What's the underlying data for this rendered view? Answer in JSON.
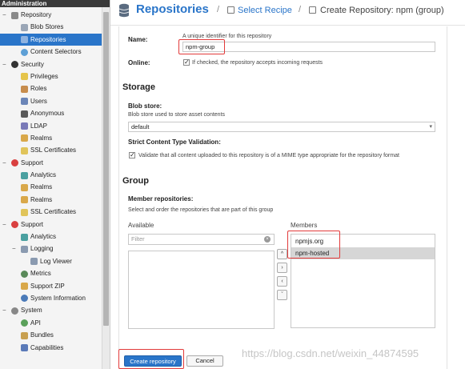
{
  "sidebar": {
    "header": "Administration",
    "items": [
      {
        "label": "Repository",
        "level": 0,
        "icon": "repository-icon",
        "toggle": "−",
        "color": "#8a8a8a",
        "dot": false,
        "active": false
      },
      {
        "label": "Blob Stores",
        "level": 1,
        "icon": "blob-stores-icon",
        "color": "#9aa6b6",
        "dot": false,
        "active": false
      },
      {
        "label": "Repositories",
        "level": 1,
        "icon": "repositories-icon",
        "color": "#8fb3e0",
        "dot": false,
        "active": true
      },
      {
        "label": "Content Selectors",
        "level": 1,
        "icon": "content-selectors-icon",
        "color": "#5ea0d6",
        "dot": true,
        "active": false
      },
      {
        "label": "Security",
        "level": 0,
        "icon": "security-icon",
        "toggle": "−",
        "color": "#333333",
        "dot": true,
        "active": false
      },
      {
        "label": "Privileges",
        "level": 1,
        "icon": "privileges-icon",
        "color": "#e5c44a",
        "dot": false,
        "active": false
      },
      {
        "label": "Roles",
        "level": 1,
        "icon": "roles-icon",
        "color": "#c78d4d",
        "dot": false,
        "active": false
      },
      {
        "label": "Users",
        "level": 1,
        "icon": "users-icon",
        "color": "#6b86b8",
        "dot": false,
        "active": false
      },
      {
        "label": "Anonymous",
        "level": 1,
        "icon": "anonymous-icon",
        "color": "#5a5a5a",
        "dot": false,
        "active": false
      },
      {
        "label": "LDAP",
        "level": 1,
        "icon": "ldap-icon",
        "color": "#7a7ab8",
        "dot": false,
        "active": false
      },
      {
        "label": "Realms",
        "level": 1,
        "icon": "realms-icon",
        "color": "#d9a84a",
        "dot": false,
        "active": false
      },
      {
        "label": "SSL Certificates",
        "level": 1,
        "icon": "ssl-certificates-icon",
        "color": "#e0c45a",
        "dot": false,
        "active": false
      },
      {
        "label": "Support",
        "level": 0,
        "icon": "support-icon",
        "toggle": "−",
        "color": "#d94040",
        "dot": true,
        "active": false
      },
      {
        "label": "Analytics",
        "level": 1,
        "icon": "analytics-icon",
        "color": "#4aa0a0",
        "dot": false,
        "active": false
      },
      {
        "label": "Realms",
        "level": 1,
        "icon": "realms-icon",
        "color": "#d9a84a",
        "dot": false,
        "active": false
      },
      {
        "label": "Realms",
        "level": 1,
        "icon": "realms-icon",
        "color": "#d9a84a",
        "dot": false,
        "active": false
      },
      {
        "label": "SSL Certificates",
        "level": 1,
        "icon": "ssl-certificates-icon",
        "color": "#e0c45a",
        "dot": false,
        "active": false
      },
      {
        "label": "Support",
        "level": 0,
        "icon": "support-icon",
        "toggle": "−",
        "color": "#d94040",
        "dot": true,
        "active": false
      },
      {
        "label": "Analytics",
        "level": 1,
        "icon": "analytics-icon",
        "color": "#4aa0a0",
        "dot": false,
        "active": false
      },
      {
        "label": "Logging",
        "level": 1,
        "icon": "logging-icon",
        "toggle": "−",
        "color": "#8a9ab0",
        "dot": false,
        "active": false
      },
      {
        "label": "Log Viewer",
        "level": 2,
        "icon": "log-viewer-icon",
        "color": "#8a9ab0",
        "dot": false,
        "active": false
      },
      {
        "label": "Metrics",
        "level": 1,
        "icon": "metrics-icon",
        "color": "#5a8a5a",
        "dot": true,
        "active": false
      },
      {
        "label": "Support ZIP",
        "level": 1,
        "icon": "support-zip-icon",
        "color": "#d9a84a",
        "dot": false,
        "active": false
      },
      {
        "label": "System Information",
        "level": 1,
        "icon": "system-information-icon",
        "color": "#4a7ab8",
        "dot": true,
        "active": false
      },
      {
        "label": "System",
        "level": 0,
        "icon": "system-icon",
        "toggle": "−",
        "color": "#888888",
        "dot": true,
        "active": false
      },
      {
        "label": "API",
        "level": 1,
        "icon": "api-icon",
        "color": "#5aa05a",
        "dot": true,
        "active": false
      },
      {
        "label": "Bundles",
        "level": 1,
        "icon": "bundles-icon",
        "color": "#c8a050",
        "dot": false,
        "active": false
      },
      {
        "label": "Capabilities",
        "level": 1,
        "icon": "capabilities-icon",
        "color": "#5a7ab8",
        "dot": false,
        "active": false
      }
    ]
  },
  "header": {
    "title": "Repositories",
    "separator": "/",
    "crumb_link": "Select Recipe",
    "crumb_current": "Create Repository: npm (group)"
  },
  "form": {
    "name_label": "Name:",
    "name_hint": "A unique identifier for this repository",
    "name_value": "npm-group",
    "online_label": "Online:",
    "online_hint": "If checked, the repository accepts incoming requests",
    "storage_title": "Storage",
    "blob_label": "Blob store:",
    "blob_hint": "Blob store used to store asset contents",
    "blob_value": "default",
    "strict_label": "Strict Content Type Validation:",
    "strict_hint": "Validate that all content uploaded to this repository is of a MIME type appropriate for the repository format",
    "group_title": "Group",
    "member_label": "Member repositories:",
    "member_hint": "Select and order the repositories that are part of this group",
    "available_label": "Available",
    "filter_placeholder": "Filter",
    "members_label": "Members",
    "members": [
      "npmjs.org",
      "npm-hosted"
    ],
    "move_buttons": [
      "^",
      "›",
      "‹",
      "ˇ"
    ],
    "create_label": "Create repository",
    "cancel_label": "Cancel"
  },
  "watermark": "https://blog.csdn.net/weixin_44874595",
  "colors": {
    "accent": "#2a75c9",
    "highlight_box": "#e23a3a",
    "sidebar_bg": "#f4f4f4"
  }
}
